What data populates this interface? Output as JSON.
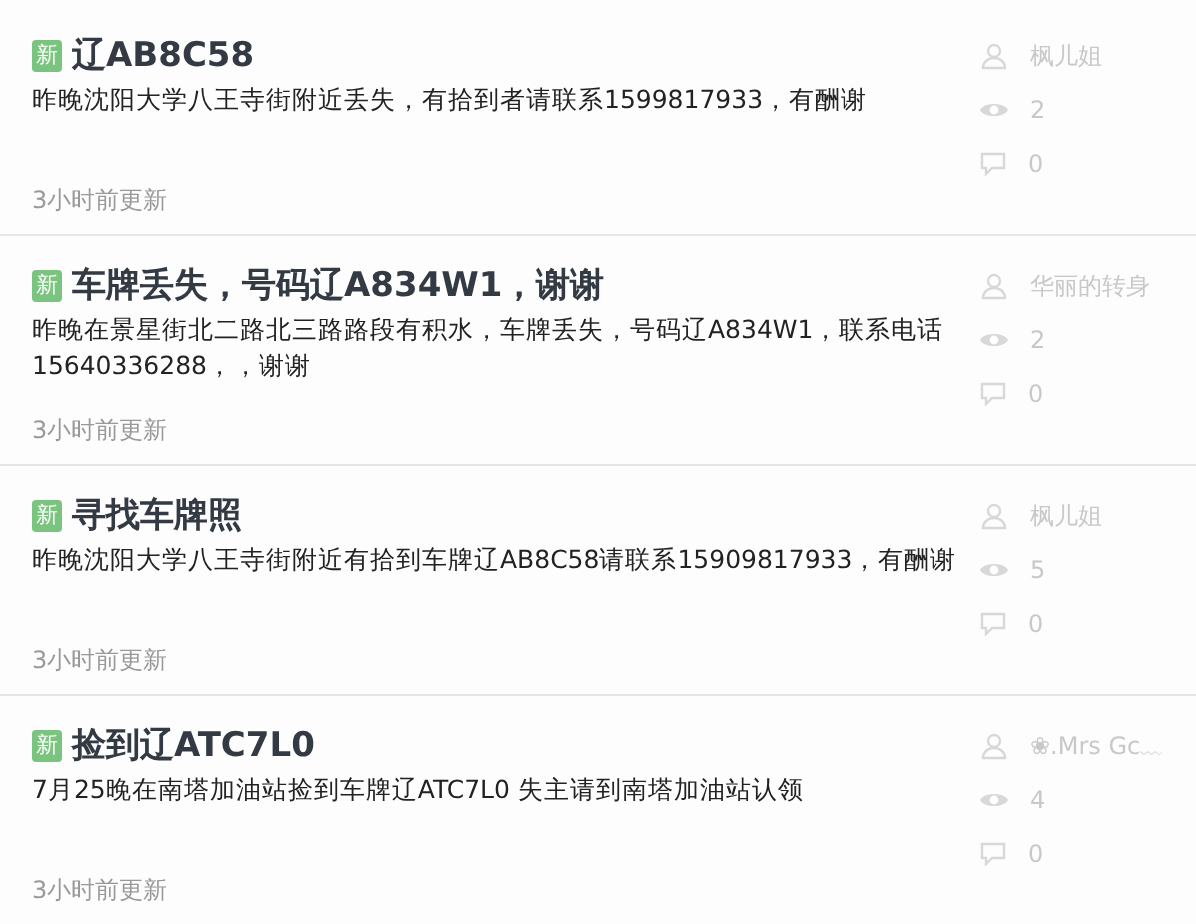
{
  "posts": [
    {
      "badge": "新",
      "title": "辽AB8C58",
      "body": "昨晚沈阳大学八王寺街附近丢失，有拾到者请联系1599817933，有酬谢",
      "updated": "3小时前更新",
      "author": "枫儿姐",
      "views": "2",
      "comments": "0"
    },
    {
      "badge": "新",
      "title": "车牌丢失，号码辽A834W1，谢谢",
      "body": "昨晚在景星街北二路北三路路段有积水，车牌丢失，号码辽A834W1，联系电话15640336288，，谢谢",
      "updated": "3小时前更新",
      "author": "华丽的转身",
      "views": "2",
      "comments": "0"
    },
    {
      "badge": "新",
      "title": "寻找车牌照",
      "body": "昨晚沈阳大学八王寺街附近有拾到车牌辽AB8C58请联系15909817933，有酬谢",
      "updated": "3小时前更新",
      "author": "枫儿姐",
      "views": "5",
      "comments": "0"
    },
    {
      "badge": "新",
      "title": "捡到辽ATC7L0",
      "body": "7月25晚在南塔加油站捡到车牌辽ATC7L0 失主请到南塔加油站认领",
      "updated": "3小时前更新",
      "author": "❀.Mrs Gc﹏",
      "views": "4",
      "comments": "0"
    }
  ]
}
